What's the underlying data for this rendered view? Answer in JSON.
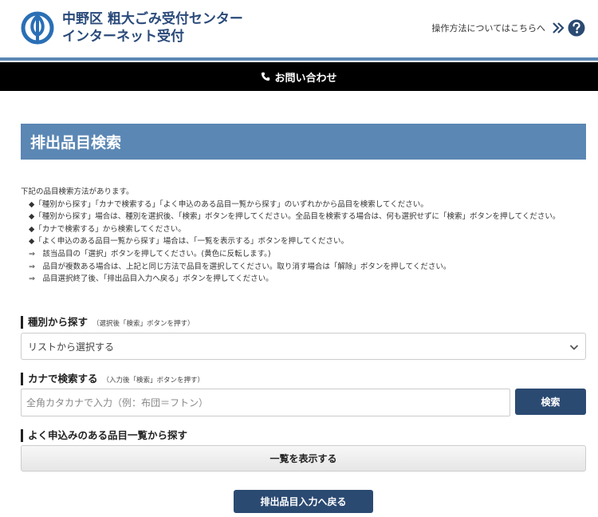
{
  "header": {
    "title_line1": "中野区 粗大ごみ受付センター",
    "title_line2": "インターネット受付",
    "help_link": "操作方法についてはこちらへ"
  },
  "contact_bar": {
    "label": "お問い合わせ"
  },
  "page_heading": "排出品目検索",
  "instructions": {
    "intro": "下記の品目検索方法があります。",
    "lines": [
      "◆「種別から探す」「カナで検索する」「よく申込のある品目一覧から探す」のいずれかから品目を検索してください。",
      "◆「種別から探す」場合は、種別を選択後、「検索」ボタンを押してください。全品目を検索する場合は、何も選択せずに「検索」ボタンを押してください。",
      "◆「カナで検索する」から検索してください。",
      "◆「よく申込のある品目一覧から探す」場合は、「一覧を表示する」ボタンを押してください。",
      "⇒　該当品目の「選択」ボタンを押してください。(黄色に反転します。)",
      "⇒　品目が複数ある場合は、上記と同じ方法で品目を選択してください。取り消す場合は「解除」ボタンを押してください。",
      "⇒　品目選択終了後、「排出品目入力へ戻る」ボタンを押してください。"
    ]
  },
  "category_section": {
    "label": "種別から探す",
    "hint": "（選択後「検索」ボタンを押す）",
    "select_value": "リストから選択する"
  },
  "kana_section": {
    "label": "カナで検索する",
    "hint": "（入力後「検索」ボタンを押す）",
    "placeholder": "全角カタカナで入力（例：布団＝フトン）",
    "search_button": "検索"
  },
  "popular_section": {
    "label": "よく申込みのある品目一覧から探す",
    "list_button": "一覧を表示する"
  },
  "back_button": "排出品目入力へ戻る",
  "colors": {
    "brand_blue": "#2b4a72",
    "heading_blue": "#5b87b4",
    "title_blue": "#2a4a7a"
  }
}
